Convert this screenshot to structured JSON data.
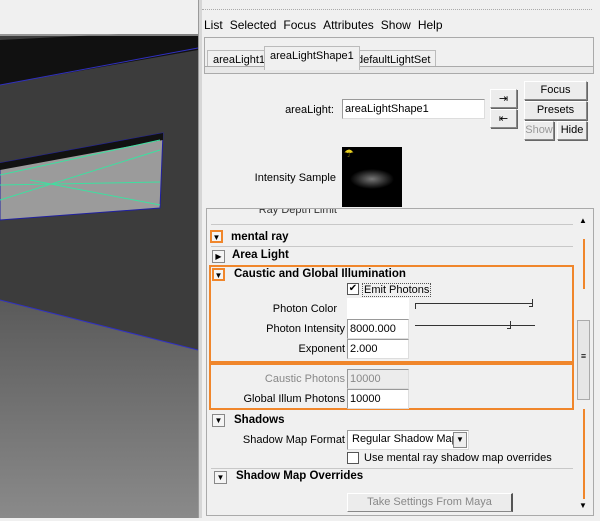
{
  "menu": [
    "List",
    "Selected",
    "Focus",
    "Attributes",
    "Show",
    "Help"
  ],
  "tabs": [
    {
      "label": "areaLight1"
    },
    {
      "label": "areaLightShape1",
      "active": true
    },
    {
      "label": "defaultLightSet"
    }
  ],
  "node": {
    "label": "areaLight:",
    "value": "areaLightShape1"
  },
  "buttons": {
    "focus": "Focus",
    "presets": "Presets",
    "show": "Show",
    "hide": "Hide"
  },
  "intensity_sample_label": "Intensity Sample",
  "cut_off_row": "Ray Depth Limit",
  "sections": {
    "mental_ray": "mental ray",
    "area_light": "Area Light",
    "caustic": "Caustic and Global Illumination",
    "shadows": "Shadows",
    "shadow_map_overrides": "Shadow Map Overrides"
  },
  "caustic": {
    "emit_photons": {
      "label": "Emit Photons",
      "checked": true
    },
    "photon_color": {
      "label": "Photon Color",
      "color": "#ffffff",
      "slider": 1.0
    },
    "photon_intensity": {
      "label": "Photon Intensity",
      "value": "8000.000",
      "slider": 0.8
    },
    "exponent": {
      "label": "Exponent",
      "value": "2.000"
    },
    "caustic_photons": {
      "label": "Caustic Photons",
      "value": "10000",
      "disabled": true
    },
    "global_illum_photons": {
      "label": "Global Illum Photons",
      "value": "10000"
    }
  },
  "shadows": {
    "format_label": "Shadow Map Format",
    "format_value": "Regular Shadow Map",
    "use_overrides": {
      "label": "Use mental ray shadow map overrides",
      "checked": false
    }
  },
  "take_settings": "Take Settings From Maya",
  "highlight_color": "#f0862b"
}
